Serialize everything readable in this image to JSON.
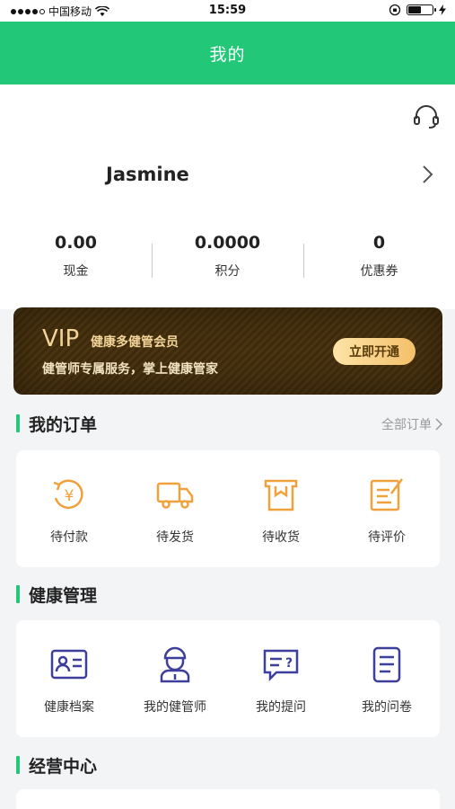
{
  "status_bar": {
    "carrier": "中国移动",
    "time": "15:59"
  },
  "header": {
    "title": "我的"
  },
  "profile": {
    "name": "Jasmine",
    "stats": [
      {
        "value": "0.00",
        "label": "现金"
      },
      {
        "value": "0.0000",
        "label": "积分"
      },
      {
        "value": "0",
        "label": "优惠券"
      }
    ]
  },
  "vip": {
    "badge": "VIP",
    "title": "健康多健管会员",
    "description": "健管师专属服务，掌上健康管家",
    "button_label": "立即开通"
  },
  "orders": {
    "title": "我的订单",
    "all_link": "全部订单",
    "items": [
      {
        "label": "待付款",
        "icon": "payment-icon"
      },
      {
        "label": "待发货",
        "icon": "truck-icon"
      },
      {
        "label": "待收货",
        "icon": "package-icon"
      },
      {
        "label": "待评价",
        "icon": "review-icon"
      }
    ]
  },
  "health": {
    "title": "健康管理",
    "items": [
      {
        "label": "健康档案",
        "icon": "health-record-icon"
      },
      {
        "label": "我的健管师",
        "icon": "health-manager-icon"
      },
      {
        "label": "我的提问",
        "icon": "question-icon"
      },
      {
        "label": "我的问卷",
        "icon": "questionnaire-icon"
      }
    ]
  },
  "business": {
    "title": "经营中心"
  },
  "colors": {
    "brand_green": "#22c878",
    "vip_gold": "#f2d399",
    "order_icon_orange": "#f0a13c",
    "health_icon_indigo": "#3d3f9a"
  }
}
